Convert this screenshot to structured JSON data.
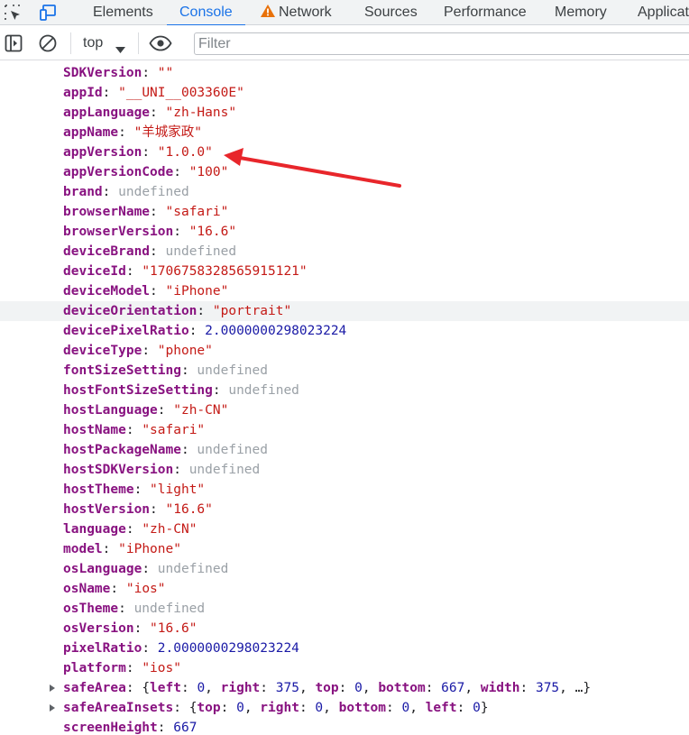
{
  "tabs": [
    {
      "label": "Elements",
      "active": false
    },
    {
      "label": "Console",
      "active": true
    },
    {
      "label": "Network",
      "active": false,
      "warning": true
    },
    {
      "label": "Sources",
      "active": false
    },
    {
      "label": "Performance",
      "active": false
    },
    {
      "label": "Memory",
      "active": false
    },
    {
      "label": "Applicat",
      "active": false
    }
  ],
  "toolbar": {
    "context": "top",
    "filter_placeholder": "Filter",
    "filter_value": ""
  },
  "colors": {
    "accent": "#1a73e8",
    "key": "#881280",
    "string": "#c41a16",
    "number": "#1a1aa6",
    "undefined": "#9aa0a6",
    "warning": "#e8710a",
    "annotation_arrow": "#e8262b"
  },
  "rows": [
    {
      "key": "SDKVersion",
      "value": "\"\"",
      "type": "s"
    },
    {
      "key": "appId",
      "value": "\"__UNI__003360E\"",
      "type": "s"
    },
    {
      "key": "appLanguage",
      "value": "\"zh-Hans\"",
      "type": "s"
    },
    {
      "key": "appName",
      "value": "\"羊城家政\"",
      "type": "s"
    },
    {
      "key": "appVersion",
      "value": "\"1.0.0\"",
      "type": "s"
    },
    {
      "key": "appVersionCode",
      "value": "\"100\"",
      "type": "s"
    },
    {
      "key": "brand",
      "value": "undefined",
      "type": "u"
    },
    {
      "key": "browserName",
      "value": "\"safari\"",
      "type": "s"
    },
    {
      "key": "browserVersion",
      "value": "\"16.6\"",
      "type": "s"
    },
    {
      "key": "deviceBrand",
      "value": "undefined",
      "type": "u"
    },
    {
      "key": "deviceId",
      "value": "\"1706758328565915121\"",
      "type": "s"
    },
    {
      "key": "deviceModel",
      "value": "\"iPhone\"",
      "type": "s"
    },
    {
      "key": "deviceOrientation",
      "value": "\"portrait\"",
      "type": "s",
      "highlighted": true
    },
    {
      "key": "devicePixelRatio",
      "value": "2.0000000298023224",
      "type": "n"
    },
    {
      "key": "deviceType",
      "value": "\"phone\"",
      "type": "s"
    },
    {
      "key": "fontSizeSetting",
      "value": "undefined",
      "type": "u"
    },
    {
      "key": "hostFontSizeSetting",
      "value": "undefined",
      "type": "u"
    },
    {
      "key": "hostLanguage",
      "value": "\"zh-CN\"",
      "type": "s"
    },
    {
      "key": "hostName",
      "value": "\"safari\"",
      "type": "s"
    },
    {
      "key": "hostPackageName",
      "value": "undefined",
      "type": "u"
    },
    {
      "key": "hostSDKVersion",
      "value": "undefined",
      "type": "u"
    },
    {
      "key": "hostTheme",
      "value": "\"light\"",
      "type": "s"
    },
    {
      "key": "hostVersion",
      "value": "\"16.6\"",
      "type": "s"
    },
    {
      "key": "language",
      "value": "\"zh-CN\"",
      "type": "s"
    },
    {
      "key": "model",
      "value": "\"iPhone\"",
      "type": "s"
    },
    {
      "key": "osLanguage",
      "value": "undefined",
      "type": "u"
    },
    {
      "key": "osName",
      "value": "\"ios\"",
      "type": "s"
    },
    {
      "key": "osTheme",
      "value": "undefined",
      "type": "u"
    },
    {
      "key": "osVersion",
      "value": "\"16.6\"",
      "type": "s"
    },
    {
      "key": "pixelRatio",
      "value": "2.0000000298023224",
      "type": "n"
    },
    {
      "key": "platform",
      "value": "\"ios\"",
      "type": "s"
    },
    {
      "key": "safeArea",
      "type": "o",
      "expandable": true,
      "parts": [
        [
          "{",
          "o"
        ],
        [
          "left",
          "k"
        ],
        [
          ": ",
          "o"
        ],
        [
          "0",
          "n"
        ],
        [
          ", ",
          "o"
        ],
        [
          "right",
          "k"
        ],
        [
          ": ",
          "o"
        ],
        [
          "375",
          "n"
        ],
        [
          ", ",
          "o"
        ],
        [
          "top",
          "k"
        ],
        [
          ": ",
          "o"
        ],
        [
          "0",
          "n"
        ],
        [
          ", ",
          "o"
        ],
        [
          "bottom",
          "k"
        ],
        [
          ": ",
          "o"
        ],
        [
          "667",
          "n"
        ],
        [
          ", ",
          "o"
        ],
        [
          "width",
          "k"
        ],
        [
          ": ",
          "o"
        ],
        [
          "375",
          "n"
        ],
        [
          ", …}",
          "o"
        ]
      ]
    },
    {
      "key": "safeAreaInsets",
      "type": "o",
      "expandable": true,
      "parts": [
        [
          "{",
          "o"
        ],
        [
          "top",
          "k"
        ],
        [
          ": ",
          "o"
        ],
        [
          "0",
          "n"
        ],
        [
          ", ",
          "o"
        ],
        [
          "right",
          "k"
        ],
        [
          ": ",
          "o"
        ],
        [
          "0",
          "n"
        ],
        [
          ", ",
          "o"
        ],
        [
          "bottom",
          "k"
        ],
        [
          ": ",
          "o"
        ],
        [
          "0",
          "n"
        ],
        [
          ", ",
          "o"
        ],
        [
          "left",
          "k"
        ],
        [
          ": ",
          "o"
        ],
        [
          "0",
          "n"
        ],
        [
          "}",
          "o"
        ]
      ]
    },
    {
      "key": "screenHeight",
      "value": "667",
      "type": "n"
    }
  ]
}
